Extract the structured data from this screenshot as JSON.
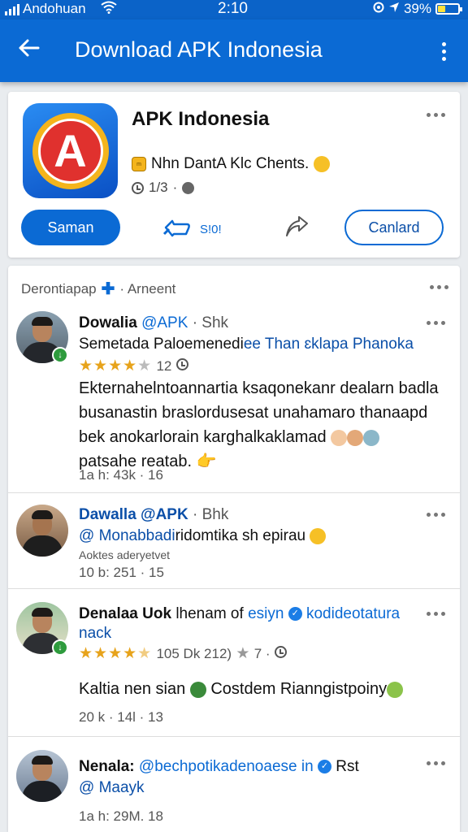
{
  "status_bar": {
    "carrier": "Andohuan",
    "time": "2:10",
    "battery": "39%",
    "battery_level": 0.39
  },
  "app_bar": {
    "title": "Download APK Indonesia",
    "back_icon": "back-arrow-icon",
    "more_icon": "more-vertical-icon"
  },
  "app_card": {
    "name": "APK Indonesia",
    "tagline": "Nhn DantA Klc Chents.",
    "meta_version": "1/3",
    "meta_sep": "·",
    "save_label": "Saman",
    "like_count": "S!0!",
    "cancel_label": "Canlard",
    "colors": {
      "accent": "#0b6ad4",
      "logo_red": "#e0312e",
      "logo_gold": "#f4b41c"
    }
  },
  "feed": {
    "section_title": "Derontiapap",
    "section_sub": "· Arneent",
    "posts": [
      {
        "author": "Dowalia",
        "handle": "@APK",
        "time": "· Shk",
        "line1": "Semetada Paloemenedi",
        "line1b": "ee Than ɛklapa Phanoka",
        "rating": 4,
        "rating_count": "12",
        "body": "Ekternahelntoannartia ksaqonekanr dealarn badla busanastin braslordusesat unahamaro thanaapd bek anokarlorain karghalkaklamad",
        "body_end": "patsahe reatab.",
        "stats": "1a h: 43k · 16"
      },
      {
        "author": "Dawalla @APK",
        "time": "· Bhk",
        "line1": "@ Monabbadi",
        "line1b": "ridomtika sh epirau",
        "line2": "Aoktes aderyetvet",
        "stats": "10 b: 251 · 15"
      },
      {
        "author": "Denalaa Uok",
        "author_rest": "lhenam of",
        "handle": "esiyn",
        "handle2": "kodideotatura",
        "line_wrap": "nack",
        "rating": 4.5,
        "rating_meta": "105 Dk 212)",
        "rating_tail": "7 ·",
        "body": "Kaltia nen sian",
        "body_b": "Costdem Rianngistpoiny",
        "stats": "20 k · 14l · 13"
      },
      {
        "author": "Nenala:",
        "handle": "@bechpotikadenoaese in",
        "tail": "Rst",
        "line1": "@ Maayk",
        "stats": "1a h: 29M. 18"
      }
    ]
  }
}
